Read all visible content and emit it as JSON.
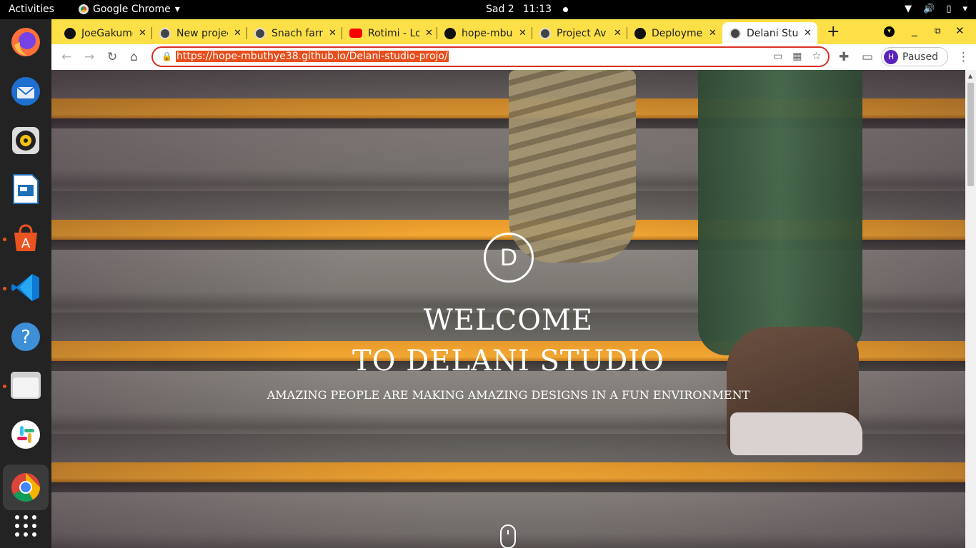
{
  "topbar": {
    "activities": "Activities",
    "app_name": "Google Chrome",
    "day": "Sad 2",
    "time": "11:13"
  },
  "dock": {
    "items": [
      "firefox-icon",
      "thunderbird-icon",
      "rhythmbox-icon",
      "libreoffice-impress-icon",
      "ubuntu-software-icon",
      "vscode-icon",
      "help-icon",
      "files-icon",
      "slack-icon",
      "chrome-icon",
      "show-apps-icon"
    ]
  },
  "tabs": [
    {
      "title": "JoeGakumo",
      "icon": "github"
    },
    {
      "title": "New project",
      "icon": "globe"
    },
    {
      "title": "Snach farm",
      "icon": "globe"
    },
    {
      "title": "Rotimi - Lo",
      "icon": "youtube"
    },
    {
      "title": "hope-mbu",
      "icon": "github"
    },
    {
      "title": "Project Av",
      "icon": "globe"
    },
    {
      "title": "Deployme",
      "icon": "github"
    },
    {
      "title": "Delani Stu",
      "icon": "globe",
      "active": true
    }
  ],
  "toolbar": {
    "url": "https://hope-mbuthye38.github.io/Delani-studio-projo/",
    "profile_initial": "H",
    "profile_status": "Paused"
  },
  "hero": {
    "logo_letter": "D",
    "title_line1": "WELCOME",
    "title_line2": "TO DELANI STUDIO",
    "subtitle": "AMAZING PEOPLE ARE MAKING AMAZING DESIGNS IN A FUN ENVIRONMENT"
  },
  "colors": {
    "tabstrip": "#fde047",
    "omnibox_border": "#d93025",
    "url_highlight": "#e84e1b",
    "dock_bg": "#232323"
  }
}
